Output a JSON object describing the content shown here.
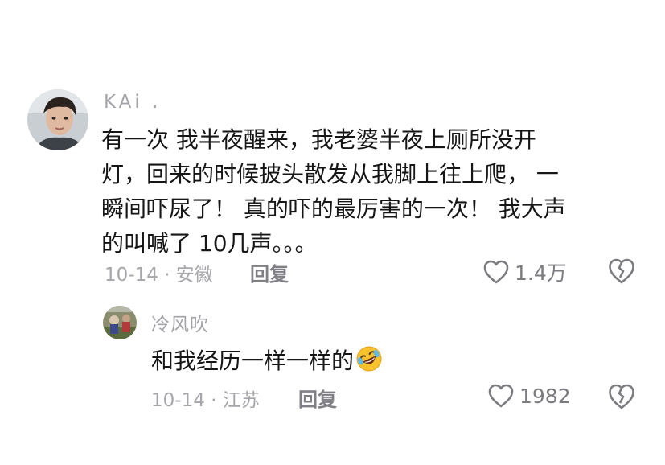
{
  "comment": {
    "username": "KAi .",
    "text_lines": [
      "有一次 我半夜醒来，我老婆半夜上厕所没开",
      "灯，回来的时候披头散发从我脚上往上爬， 一",
      "瞬间吓尿了！ 真的吓的最厉害的一次！ 我大声",
      "的叫喊了 10几声。。。"
    ],
    "meta": "10-14 · 安徽",
    "reply_label": "回复",
    "like_count": "1.4万",
    "avatar_icon": "user-avatar-photo"
  },
  "reply": {
    "username": "冷风吹",
    "text": "和我经历一样一样的",
    "emoji": "rolling-on-floor-laughing-emoji",
    "meta": "10-14 · 江苏",
    "reply_label": "回复",
    "like_count": "1982",
    "avatar_icon": "user-avatar-photo"
  },
  "colors": {
    "text": "#161616",
    "muted": "#a5a5aa",
    "reply_button": "#7f7f85",
    "icon": "#7b7b80"
  }
}
